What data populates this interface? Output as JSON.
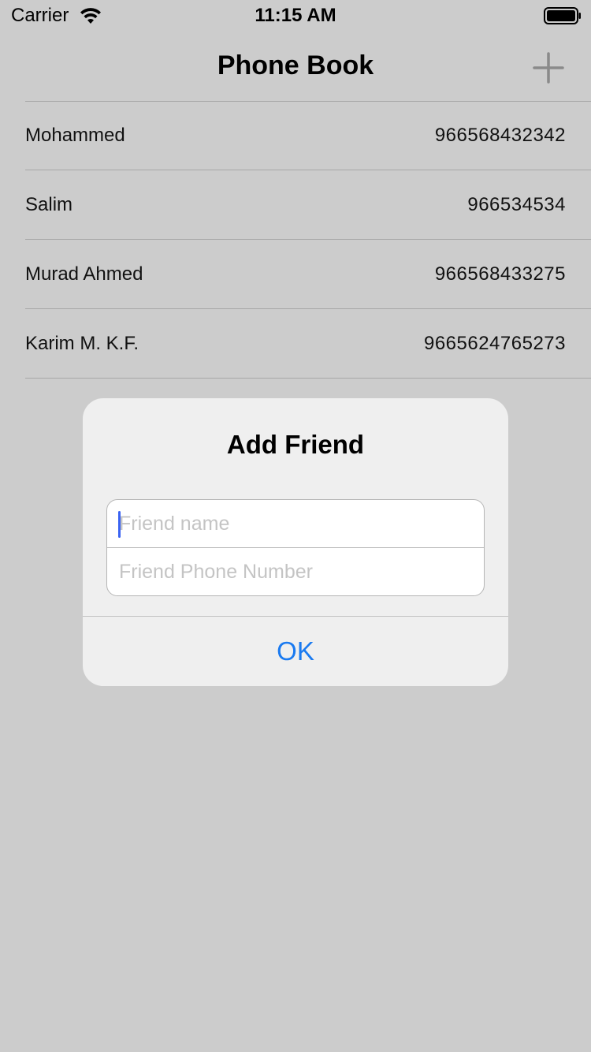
{
  "status_bar": {
    "carrier": "Carrier",
    "time": "11:15 AM",
    "wifi_icon": "wifi-icon",
    "battery_icon": "battery-icon"
  },
  "nav": {
    "title": "Phone Book",
    "add_icon": "plus-icon"
  },
  "contacts": [
    {
      "name": "Mohammed",
      "phone": "966568432342"
    },
    {
      "name": "Salim",
      "phone": "966534534"
    },
    {
      "name": "Murad Ahmed",
      "phone": "966568433275"
    },
    {
      "name": "Karim M. K.F.",
      "phone": "9665624765273"
    }
  ],
  "alert": {
    "title": "Add Friend",
    "name_field": {
      "value": "",
      "placeholder": "Friend name"
    },
    "phone_field": {
      "value": "",
      "placeholder": "Friend Phone Number"
    },
    "ok_label": "OK"
  },
  "colors": {
    "background": "#cccccc",
    "alert_background": "#efefef",
    "accent": "#1a7af0",
    "caret": "#3a63f2"
  }
}
